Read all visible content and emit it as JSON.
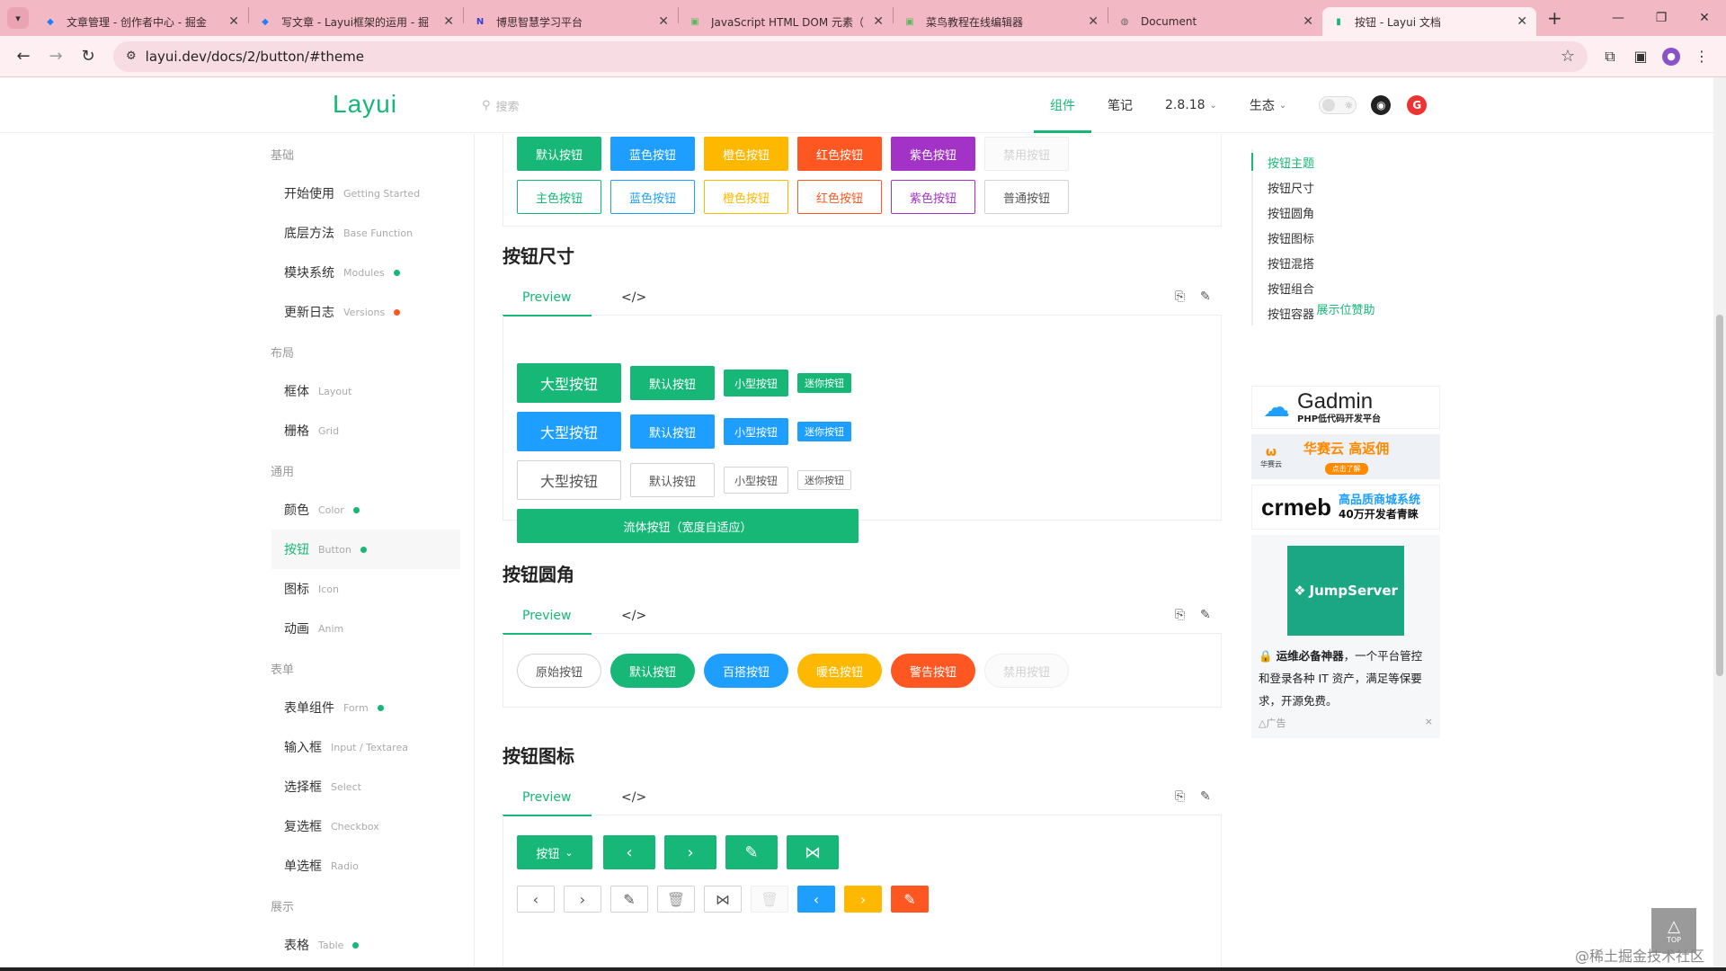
{
  "browser": {
    "tabs": [
      {
        "title": "文章管理 - 创作者中心 - 掘金",
        "icon": "juejin-icon",
        "color": "#1e80ff"
      },
      {
        "title": "写文章 - Layui框架的运用 - 掘",
        "icon": "juejin-icon",
        "color": "#1e80ff"
      },
      {
        "title": "博思智慧学习平台",
        "icon": "n-icon",
        "color": "#3b3bd6"
      },
      {
        "title": "JavaScript HTML DOM 元素（",
        "icon": "runoob-icon",
        "color": "#5cb85c"
      },
      {
        "title": "菜鸟教程在线编辑器",
        "icon": "runoob-icon",
        "color": "#5cb85c"
      },
      {
        "title": "Document",
        "icon": "globe-icon",
        "color": "#666"
      },
      {
        "title": "按钮 - Layui 文档",
        "icon": "layui-icon",
        "color": "#16b777"
      }
    ],
    "url": "layui.dev/docs/2/button/#theme"
  },
  "header": {
    "logo": "Layui",
    "search_placeholder": "搜索",
    "nav": [
      {
        "label": "组件",
        "active": true
      },
      {
        "label": "笔记",
        "active": false
      },
      {
        "label": "2.8.18",
        "active": false,
        "dropdown": true
      },
      {
        "label": "生态",
        "active": false,
        "dropdown": true
      }
    ]
  },
  "sidebar": {
    "groups": [
      {
        "label": "基础",
        "items": [
          {
            "label": "开始使用",
            "en": "Getting Started",
            "dot": ""
          },
          {
            "label": "底层方法",
            "en": "Base Function",
            "dot": ""
          },
          {
            "label": "模块系统",
            "en": "Modules",
            "dot": "#16b777"
          },
          {
            "label": "更新日志",
            "en": "Versions",
            "dot": "#ff5722"
          }
        ]
      },
      {
        "label": "布局",
        "items": [
          {
            "label": "框体",
            "en": "Layout",
            "dot": ""
          },
          {
            "label": "栅格",
            "en": "Grid",
            "dot": ""
          }
        ]
      },
      {
        "label": "通用",
        "items": [
          {
            "label": "颜色",
            "en": "Color",
            "dot": "#16b777"
          },
          {
            "label": "按钮",
            "en": "Button",
            "dot": "#16b777",
            "active": true
          },
          {
            "label": "图标",
            "en": "Icon",
            "dot": ""
          },
          {
            "label": "动画",
            "en": "Anim",
            "dot": ""
          }
        ]
      },
      {
        "label": "表单",
        "items": [
          {
            "label": "表单组件",
            "en": "Form",
            "dot": "#16b777"
          },
          {
            "label": "输入框",
            "en": "Input / Textarea",
            "dot": ""
          },
          {
            "label": "选择框",
            "en": "Select",
            "dot": ""
          },
          {
            "label": "复选框",
            "en": "Checkbox",
            "dot": ""
          },
          {
            "label": "单选框",
            "en": "Radio",
            "dot": ""
          }
        ]
      },
      {
        "label": "展示",
        "items": [
          {
            "label": "表格",
            "en": "Table",
            "dot": "#16b777"
          }
        ]
      }
    ]
  },
  "colors": {
    "green": "#16b777",
    "blue": "#1e9fff",
    "orange": "#ffb800",
    "red": "#ff5722",
    "purple": "#a233c6",
    "disabled": "#fbfbfb"
  },
  "theme_section": {
    "row1": [
      "默认按钮",
      "蓝色按钮",
      "橙色按钮",
      "红色按钮",
      "紫色按钮",
      "禁用按钮"
    ],
    "row2": [
      "主色按钮",
      "蓝色按钮",
      "橙色按钮",
      "红色按钮",
      "紫色按钮",
      "普通按钮"
    ]
  },
  "size_section": {
    "title": "按钮尺寸",
    "tab_preview": "Preview",
    "tab_code": "</>",
    "sizes": [
      "大型按钮",
      "默认按钮",
      "小型按钮",
      "迷你按钮"
    ],
    "fluid": "流体按钮（宽度自适应）"
  },
  "radius_section": {
    "title": "按钮圆角",
    "tab_preview": "Preview",
    "tab_code": "</>",
    "buttons": [
      "原始按钮",
      "默认按钮",
      "百搭按钮",
      "暖色按钮",
      "警告按钮",
      "禁用按钮"
    ]
  },
  "icon_section": {
    "title": "按钮图标",
    "tab_preview": "Preview",
    "tab_code": "</>",
    "dropdown_label": "按钮"
  },
  "toc": {
    "items": [
      {
        "label": "按钮主题",
        "active": true
      },
      {
        "label": "按钮尺寸"
      },
      {
        "label": "按钮圆角"
      },
      {
        "label": "按钮图标"
      },
      {
        "label": "按钮混搭"
      },
      {
        "label": "按钮组合"
      },
      {
        "label": "按钮容器"
      }
    ],
    "sponsor_title": "展示位赞助"
  },
  "ads": {
    "gadmin_name": "Gadmin",
    "gadmin_sub": "PHP低代码开发平台",
    "huasai_text": "华赛云 高返佣",
    "huasai_sub": "点击了解",
    "huasai_brand": "华赛云",
    "crmeb_name": "crmeb",
    "crmeb_line1": "高品质商城系统",
    "crmeb_line2": "40万开发者青睐",
    "jumpserver_name": "JumpServer",
    "jumpserver_desc_bold": "运维必备神器",
    "jumpserver_desc": "，一个平台管控和登录各种 IT 资产，满足等保要求，开源免费。",
    "ad_label": "广告"
  },
  "watermark": "@稀土掘金技术社区",
  "totop": "TOP"
}
